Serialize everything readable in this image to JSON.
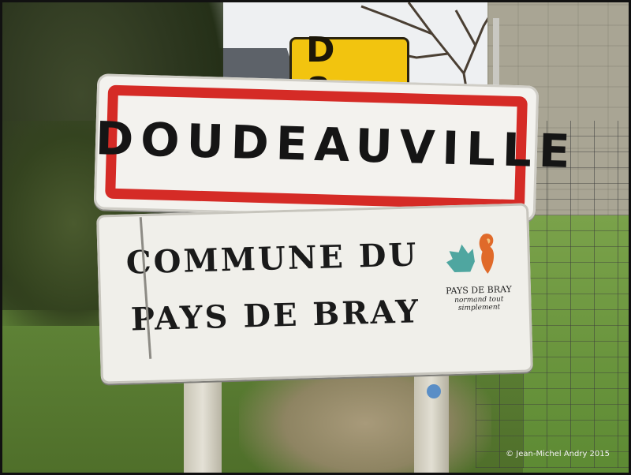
{
  "route_plate": {
    "text": "D 8"
  },
  "town_sign": {
    "name": "DOUDEAUVILLE"
  },
  "commune_sign": {
    "line1": "COMMUNE DU",
    "line2": "PAYS DE BRAY",
    "logo_name": "PAYS DE BRAY",
    "logo_tagline": "normand tout simplement"
  },
  "photo_credit": "© Jean-Michel Andry 2015",
  "colors": {
    "sign_border_red": "#d52b26",
    "route_plate_yellow": "#f2c40f",
    "sign_white": "#f3f2ee"
  },
  "icons": [
    "pays-de-bray-logo-icon"
  ]
}
